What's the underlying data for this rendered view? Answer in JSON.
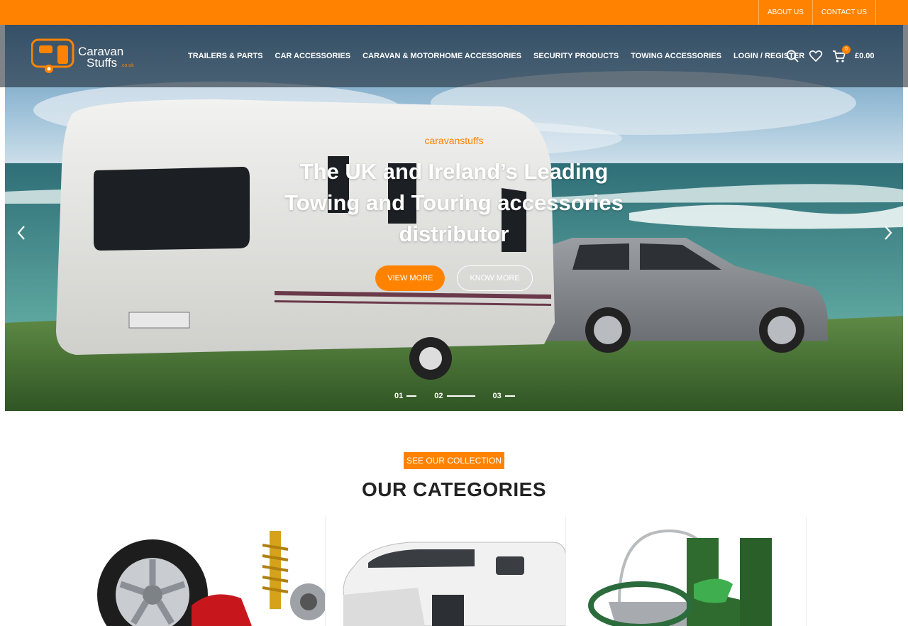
{
  "topbar": {
    "about": "ABOUT US",
    "contact": "CONTACT US"
  },
  "logo": {
    "line1": "Caravan",
    "line2": "Stuffs",
    "suffix": ".co.uk"
  },
  "nav": {
    "items": [
      "TRAILERS & PARTS",
      "CAR ACCESSORIES",
      "CARAVAN & MOTORHOME ACCESSORIES",
      "SECURITY PRODUCTS",
      "TOWING ACCESSORIES",
      "LOGIN / REGISTER"
    ]
  },
  "cart": {
    "count": "0",
    "total": "£0.00"
  },
  "hero": {
    "eyebrow": "caravanstuffs",
    "title": "The UK and Ireland’s Leading Towing and Touring accessories distributor",
    "btn_primary": "VIEW MORE",
    "btn_secondary": "KNOW MORE",
    "slides": [
      "01",
      "02",
      "03"
    ],
    "active_slide": 2
  },
  "section": {
    "tag": "SEE OUR COLLECTION",
    "title": "OUR CATEGORIES"
  },
  "icons": {
    "search": "search-icon",
    "wishlist": "heart-icon",
    "cart": "cart-icon",
    "prev": "chevron-left-icon",
    "next": "chevron-right-icon"
  },
  "colors": {
    "accent": "#ff8300",
    "dark_text": "#222222"
  }
}
